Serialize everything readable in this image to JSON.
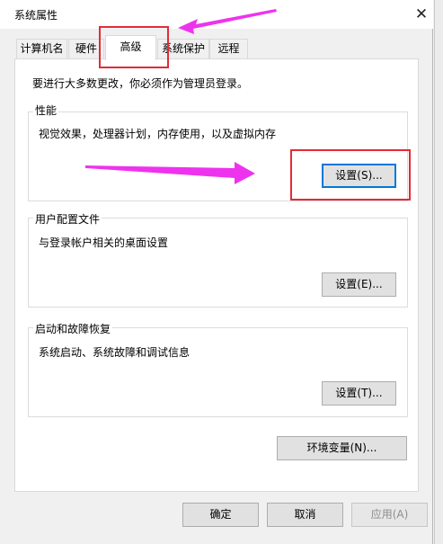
{
  "window": {
    "title": "系统属性",
    "close_glyph": "✕"
  },
  "tabs": [
    {
      "label": "计算机名"
    },
    {
      "label": "硬件"
    },
    {
      "label": "高级"
    },
    {
      "label": "系统保护"
    },
    {
      "label": "远程"
    }
  ],
  "notice": "要进行大多数更改，你必须作为管理员登录。",
  "performance": {
    "title": "性能",
    "description": "视觉效果，处理器计划，内存使用，以及虚拟内存",
    "button": "设置(S)..."
  },
  "user_profiles": {
    "title": "用户配置文件",
    "description": "与登录帐户相关的桌面设置",
    "button": "设置(E)..."
  },
  "startup_recovery": {
    "title": "启动和故障恢复",
    "description": "系统启动、系统故障和调试信息",
    "button": "设置(T)..."
  },
  "env_button": "环境变量(N)...",
  "footer": {
    "ok": "确定",
    "cancel": "取消",
    "apply": "应用(A)"
  },
  "colors": {
    "annotation_arrow": "#ee33ee",
    "highlight_box": "#e32b36",
    "focus_blue": "#0078d7"
  }
}
